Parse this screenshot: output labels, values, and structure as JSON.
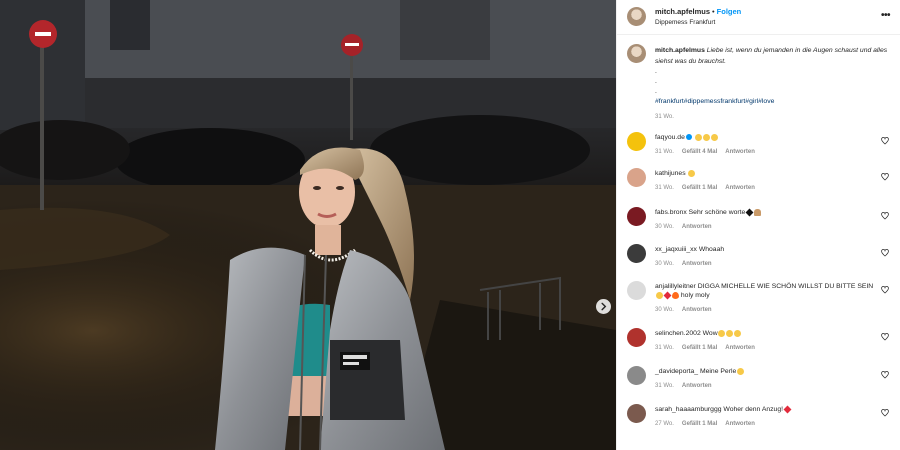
{
  "post": {
    "username": "mitch.apfelmus",
    "follow_label": "Folgen",
    "separator": "•",
    "location": "Dippemess Frankfurt",
    "more_label": "•••"
  },
  "caption": {
    "username": "mitch.apfelmus",
    "text": "Liebe ist, wenn du jemanden in die Augen schaust und alles siehst was du brauchst.",
    "dots": [
      ".",
      ".",
      "."
    ],
    "hashtags": "#frankfurt#dippemessfrankfurt#girl#love",
    "time": "31 Wo."
  },
  "comments": [
    {
      "username": "faqyou.de",
      "verified": true,
      "text": "",
      "emojis": [
        "laugh",
        "laugh",
        "laugh"
      ],
      "time": "31 Wo.",
      "likes": "Gefällt 4 Mal",
      "reply": "Antworten",
      "avatar": "#f4c20d"
    },
    {
      "username": "kathijunes",
      "text": "",
      "emojis": [
        "laugh"
      ],
      "time": "31 Wo.",
      "likes": "Gefällt 1 Mal",
      "reply": "Antworten",
      "avatar": "#d9a38a"
    },
    {
      "username": "fabs.bronx",
      "text": "Sehr schöne worte",
      "emojis": [
        "black",
        "pray"
      ],
      "time": "30 Wo.",
      "likes": "",
      "reply": "Antworten",
      "avatar": "#7a1a22"
    },
    {
      "username": "xx_jaqxuiii_xx",
      "text": "Whoaah",
      "emojis": [],
      "time": "30 Wo.",
      "likes": "",
      "reply": "Antworten",
      "avatar": "#3b3b3b"
    },
    {
      "username": "anjalillyleitner",
      "text": "DIGGA MICHELLE WIE SCHÖN WILLST DU BITTE SEIN",
      "emojis": [
        "laugh",
        "red",
        "flame"
      ],
      "text_after": "holy moly",
      "time": "30 Wo.",
      "likes": "",
      "reply": "Antworten",
      "avatar": "#dbdbdb"
    },
    {
      "username": "selinchen.2002",
      "text": "Wow",
      "emojis": [
        "laugh",
        "laugh",
        "laugh"
      ],
      "time": "31 Wo.",
      "likes": "Gefällt 1 Mal",
      "reply": "Antworten",
      "avatar": "#b0322d"
    },
    {
      "username": "_davideporta_",
      "text": "Meine Perle",
      "emojis": [
        "laugh"
      ],
      "time": "31 Wo.",
      "likes": "",
      "reply": "Antworten",
      "avatar": "#8a8a8a"
    },
    {
      "username": "sarah_haaaamburggg",
      "text": "Woher denn Anzug!",
      "emojis": [
        "red"
      ],
      "time": "27 Wo.",
      "likes": "Gefällt 1 Mal",
      "reply": "Antworten",
      "avatar": "#7b5a4e"
    }
  ],
  "colors": {
    "accent": "#0095f6",
    "hashtag": "#00376b",
    "muted": "#8e8e8e",
    "text": "#262626"
  },
  "icons": {
    "next": "chevron-right-icon",
    "like": "heart-icon",
    "more": "more-icon"
  }
}
